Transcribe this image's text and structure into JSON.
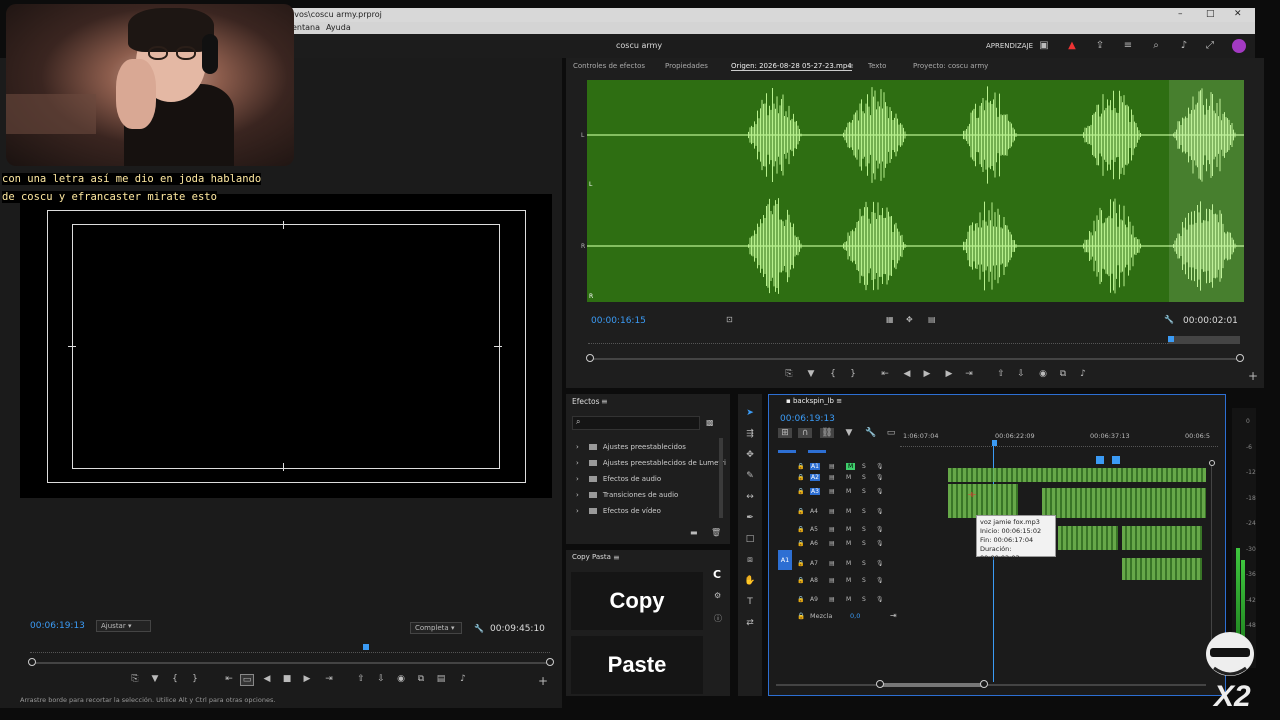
{
  "window": {
    "path": "ivos\\coscu army.prproj",
    "controls": [
      "–",
      "□",
      "✕"
    ]
  },
  "menu": [
    "entana",
    "Ayuda"
  ],
  "appbar": {
    "project_title": "coscu army",
    "learning": "APRENDIZAJE"
  },
  "subtitles": [
    "con una letra así me dio en joda hablando",
    "de coscu y efrancaster mirate esto"
  ],
  "program_monitor": {
    "timecode": "00:06:19:13",
    "fit": "Ajustar",
    "quality": "Completa",
    "duration": "00:09:45:10",
    "playhead_fraction": 0.64
  },
  "source_monitor": {
    "tabs": [
      "Controles de efectos",
      "Propiedades",
      "Origen: 2026-08-28 05-27-23.mp4",
      "Texto",
      "Proyecto: coscu army"
    ],
    "timecode": "00:00:16:15",
    "duration": "00:00:02:01",
    "channel_labels": [
      "L",
      "L",
      "R",
      "R"
    ]
  },
  "effects": {
    "title": "Efectos",
    "items": [
      "Ajustes preestablecidos",
      "Ajustes preestablecidos de Lumetri",
      "Efectos de audio",
      "Transiciones de audio",
      "Efectos de vídeo"
    ]
  },
  "copy_pasta": {
    "title": "Copy Pasta",
    "copy_label": "Copy",
    "paste_label": "Paste"
  },
  "timeline": {
    "sequence": "backspin_lb",
    "timecode": "00:06:19:13",
    "ruler": [
      "1:06:07:04",
      "00:06:22:09",
      "00:06:37:13",
      "00:06:5"
    ],
    "tracks": [
      "A1",
      "A2",
      "A3",
      "A4",
      "A5",
      "A6",
      "A7",
      "A8",
      "A9"
    ],
    "source_patch": "A1",
    "mix_label": "Mezcla",
    "mix_value": "0,0",
    "tooltip": [
      "voz jamie fox.mp3",
      "Inicio: 00:06:15:02",
      "Fin: 00:06:17:04",
      "Duración: 00:00:02:03"
    ]
  },
  "vu_scale": [
    "0",
    "-6",
    "-12",
    "-18",
    "-24",
    "-30",
    "-36",
    "-42",
    "-48"
  ],
  "status": "Arrastre borde para recortar la selección. Utilice Alt y Ctrl para otras opciones.",
  "colors": {
    "accent": "#3b9bf5",
    "waveform_bg": "#2e6e12",
    "waveform_fg": "#b8f08e",
    "clip_green": "#6fb84e"
  }
}
